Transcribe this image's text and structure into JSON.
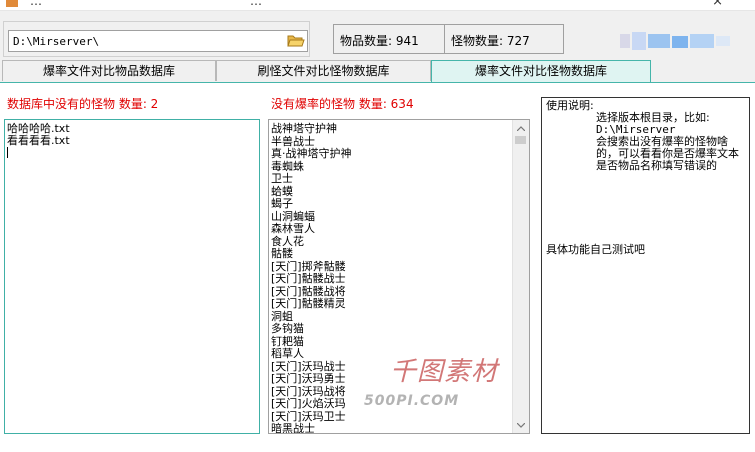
{
  "window": {
    "title_left": "…",
    "title_center": "…",
    "close_glyph": "×"
  },
  "toolbar": {
    "path_value": "D:\\Mirserver\\",
    "item_count_text": "物品数量: 941",
    "monster_count_text": "怪物数量: 727"
  },
  "tabs": [
    {
      "label": "爆率文件对比物品数据库",
      "active": false
    },
    {
      "label": "刷怪文件对比怪物数据库",
      "active": false
    },
    {
      "label": "爆率文件对比怪物数据库",
      "active": true
    }
  ],
  "left_panel": {
    "label": "数据库中没有的怪物  数量: 2",
    "items": [
      "哈哈哈哈.txt",
      "看看看看.txt"
    ]
  },
  "middle_panel": {
    "label": "没有爆率的怪物  数量: 634",
    "items": [
      "战神塔守护神",
      "半兽战士",
      "真·战神塔守护神",
      "毒蜘蛛",
      "卫士",
      "蛤蟆",
      "蝎子",
      "山洞蝙蝠",
      "森林雪人",
      "食人花",
      "骷髅",
      "[天门]掷斧骷髅",
      "[天门]骷髅战士",
      "[天门]骷髅战将",
      "[天门]骷髅精灵",
      "洞蛆",
      "多钩猫",
      "钉耙猫",
      "稻草人",
      "[天门]沃玛战士",
      "[天门]沃玛勇士",
      "[天门]沃玛战将",
      "[天门]火焰沃玛",
      "[天门]沃玛卫士",
      "暗黑战士",
      "粪虫"
    ]
  },
  "help_panel": {
    "title": "使用说明:",
    "line1": "选择版本根目录，比如:",
    "line2": "D:\\Mirserver",
    "line3": "会搜索出没有爆率的怪物啥的，可以看看你是否爆率文本是否物品名称填写错误的",
    "line4": "具体功能自己测试吧"
  },
  "watermark": {
    "cn": "千图素材",
    "en": "500PI.COM"
  },
  "colors": {
    "accent": "#45b5aa",
    "active_tab_bg": "#dff4f2",
    "warning_text": "#e00000"
  },
  "icons": {
    "folder": "folder-open-icon",
    "scroll_up": "chevron-up-icon",
    "scroll_down": "chevron-down-icon"
  }
}
